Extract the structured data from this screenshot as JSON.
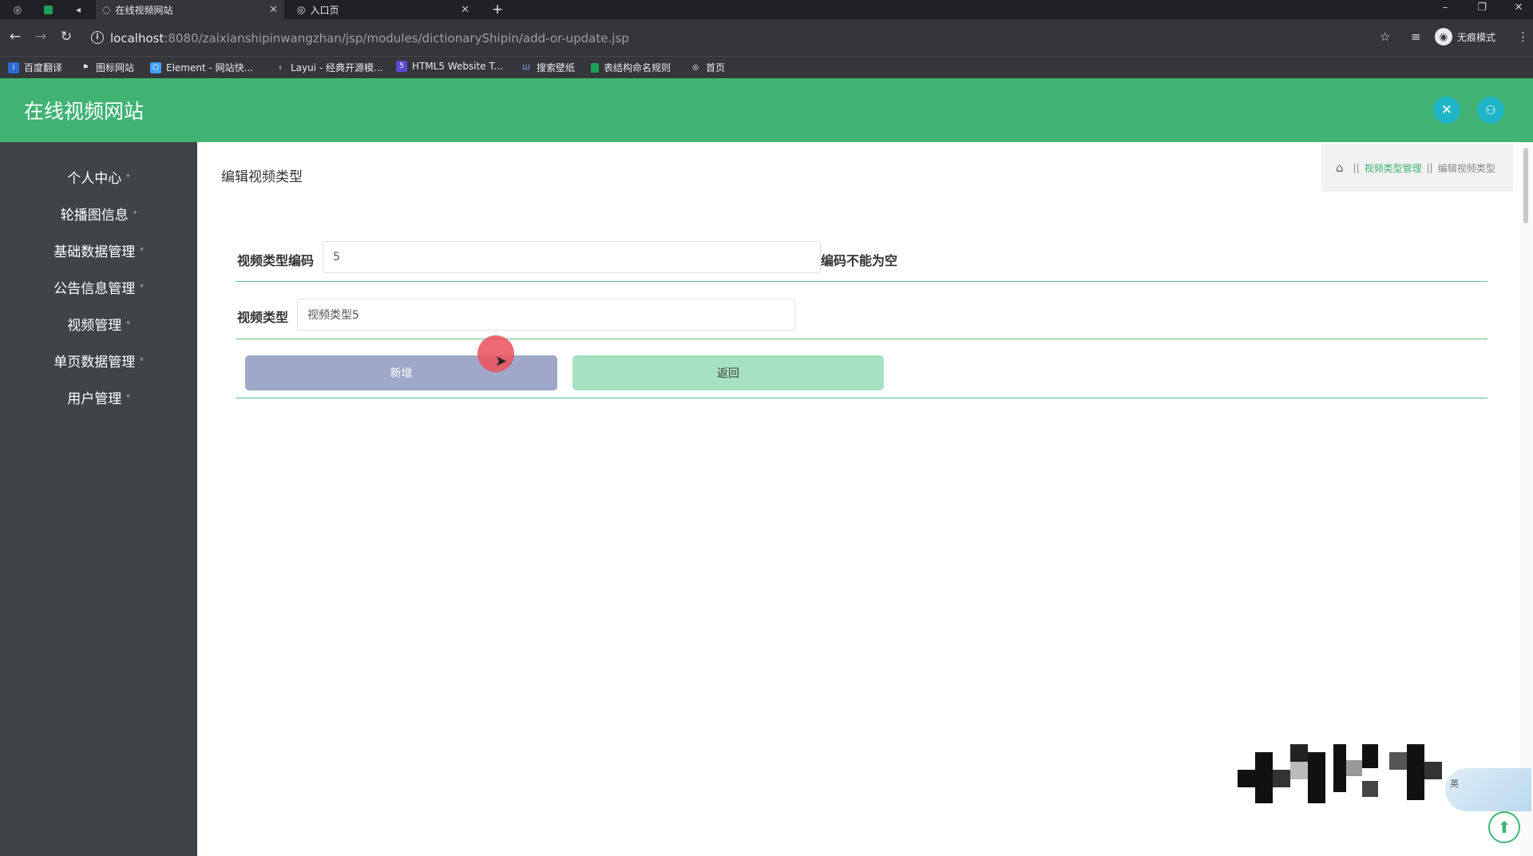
{
  "browser": {
    "tabs": [
      {
        "title": "在线视频网站",
        "active": true
      },
      {
        "title": "入口页",
        "active": false
      }
    ],
    "new_tab": "+",
    "url_host": "localhost",
    "url_rest": ":8080/zaixianshipinwangzhan/jsp/modules/dictionaryShipin/add-or-update.jsp",
    "profile_label": "无痕模式",
    "bookmarks": [
      {
        "label": "百度翻译",
        "color": "#2b6cd4"
      },
      {
        "label": "图标网站",
        "color": "#555555"
      },
      {
        "label": "Element - 网站快...",
        "color": "#409eff"
      },
      {
        "label": "Layui - 经典开源模...",
        "color": "#666666"
      },
      {
        "label": "HTML5 Website T...",
        "color": "#5b4bd1"
      },
      {
        "label": "搜索壁纸",
        "color": "#3a62c9"
      },
      {
        "label": "表结构命名规则",
        "color": "#1da15a"
      },
      {
        "label": "首页",
        "color": "#777777"
      }
    ]
  },
  "header": {
    "title": "在线视频网站",
    "fullscreen_icon": "✕",
    "user_icon": "👤"
  },
  "sidebar": {
    "items": [
      {
        "label": "个人中心"
      },
      {
        "label": "轮播图信息"
      },
      {
        "label": "基础数据管理"
      },
      {
        "label": "公告信息管理"
      },
      {
        "label": "视频管理"
      },
      {
        "label": "单页数据管理"
      },
      {
        "label": "用户管理"
      }
    ]
  },
  "main": {
    "page_title": "编辑视频类型",
    "breadcrumb": {
      "sep": "||",
      "parent": "视频类型管理",
      "current": "编辑视频类型"
    },
    "form": {
      "code_label": "视频类型编码",
      "code_value": "5",
      "code_hint": "编码不能为空",
      "type_label": "视频类型",
      "type_value": "视频类型5",
      "add_button": "新增",
      "back_button": "返回"
    }
  },
  "widget": {
    "label": "英"
  },
  "colors": {
    "header_bg": "#40b373",
    "sidebar_bg": "#3e4448",
    "accent": "#40b373",
    "add_button": "#9fa8c8",
    "back_button": "#a6e2c2"
  }
}
